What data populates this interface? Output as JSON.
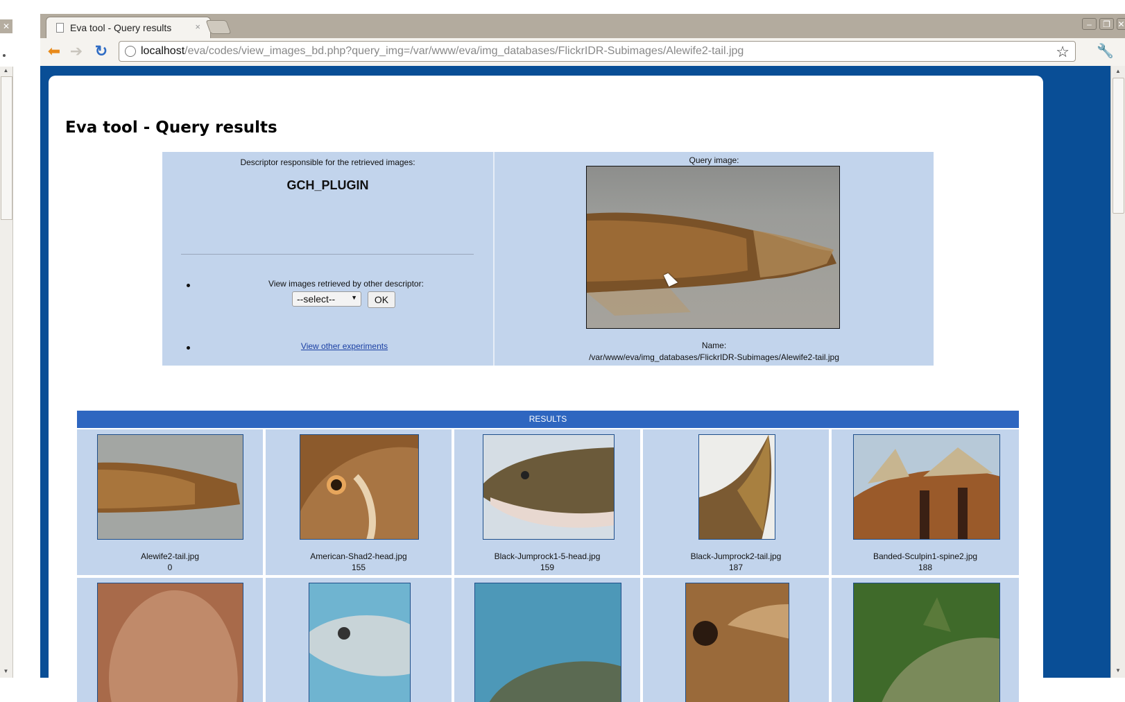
{
  "browser": {
    "tab_title": "Eva tool - Query results",
    "tab_close": "×",
    "url_host": "localhost",
    "url_path": "/eva/codes/view_images_bd.php?query_img=/var/www/eva/img_databases/FlickrIDR-Subimages/Alewife2-tail.jpg"
  },
  "page": {
    "title": "Eva tool - Query results"
  },
  "descriptor": {
    "caption": "Descriptor responsible for the retrieved images:",
    "name": "GCH_PLUGIN",
    "other_caption": "View images retrieved by other descriptor:",
    "select_value": "--select--",
    "ok_label": "OK",
    "experiments_link": "View other experiments"
  },
  "query": {
    "caption": "Query image:",
    "name_label": "Name:",
    "name_value": "/var/www/eva/img_databases/FlickrIDR-Subimages/Alewife2-tail.jpg"
  },
  "results": {
    "header": "RESULTS",
    "items": [
      {
        "name": "Alewife2-tail.jpg",
        "score": "0"
      },
      {
        "name": "American-Shad2-head.jpg",
        "score": "155"
      },
      {
        "name": "Black-Jumprock1-5-head.jpg",
        "score": "159"
      },
      {
        "name": "Black-Jumprock2-tail.jpg",
        "score": "187"
      },
      {
        "name": "Banded-Sculpin1-spine2.jpg",
        "score": "188"
      }
    ]
  },
  "colors": {
    "page_frame": "#094e96",
    "panel_bg": "#c2d4ec",
    "results_header": "#2e66c0",
    "link": "#1a3fa3"
  }
}
